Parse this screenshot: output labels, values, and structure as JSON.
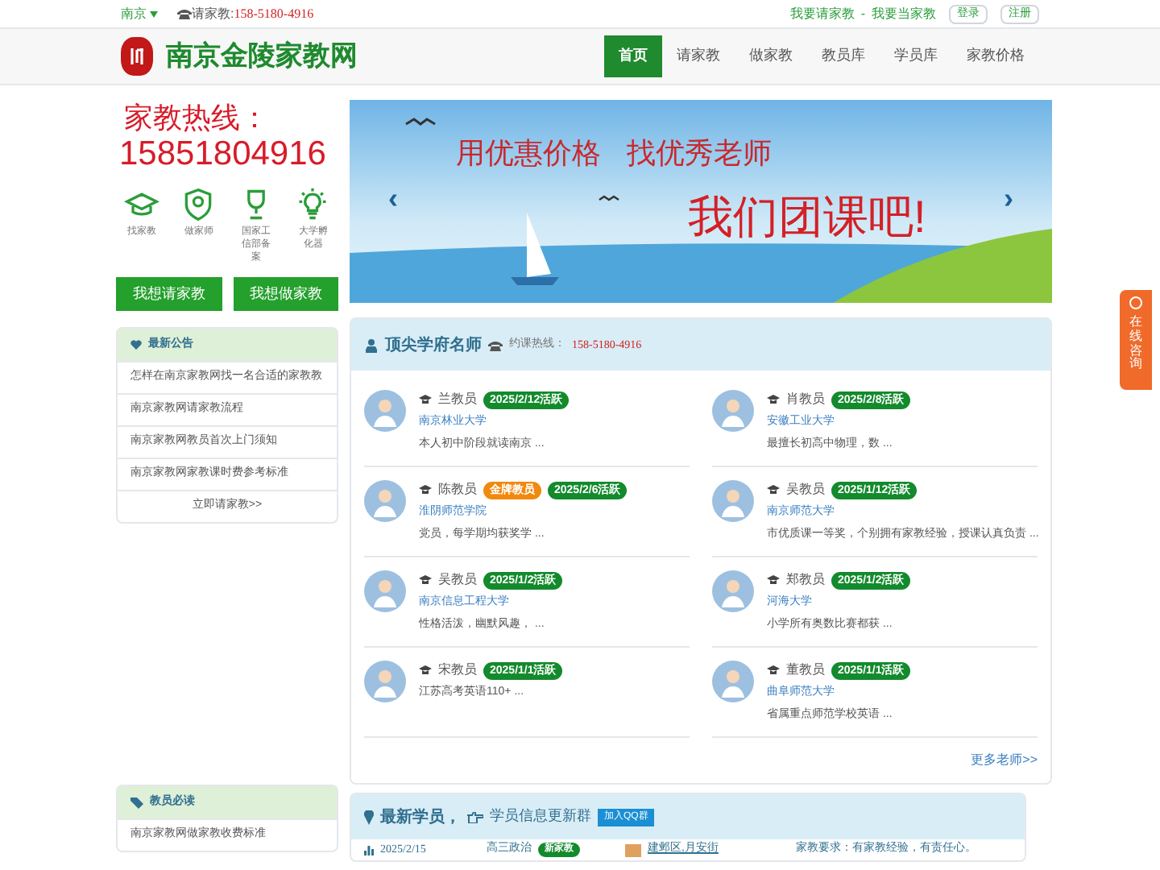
{
  "topbar": {
    "city": "南京",
    "phone_label": "请家教:",
    "phone": "158-5180-4916",
    "links": [
      "我要请家教",
      "-",
      "我要当家教"
    ],
    "buttons": [
      "登录",
      "注册"
    ]
  },
  "header": {
    "site_name": "南京金陵家教网",
    "nav": [
      {
        "label": "首页",
        "selected": true
      },
      {
        "label": "请家教",
        "selected": false
      },
      {
        "label": "做家教",
        "selected": false
      },
      {
        "label": "教员库",
        "selected": false
      },
      {
        "label": "学员库",
        "selected": false
      },
      {
        "label": "家教价格",
        "selected": false
      }
    ]
  },
  "hotline": {
    "title": "家教热线：",
    "number": "15851804916"
  },
  "features": [
    {
      "kind": "cap",
      "label": "找家教"
    },
    {
      "kind": "shield",
      "label": "做家师"
    },
    {
      "kind": "trophy",
      "label": "国家工信部备案"
    },
    {
      "kind": "bulb",
      "label": "大学孵化器"
    }
  ],
  "actions": [
    "我想请家教",
    "我想做家教"
  ],
  "notices": {
    "title": "最新公告",
    "items": [
      "怎样在南京家教网找一名合适的家教教",
      "南京家教网请家教流程",
      "南京家教网教员首次上门须知",
      "南京家教网家教课时费参考标准"
    ],
    "more": "立即请家教>>"
  },
  "banner": {
    "line1": "用优惠价格",
    "line2": "找优秀老师",
    "line3": "我们团课吧!",
    "prev": "‹",
    "next": "›"
  },
  "teachers": {
    "title": "顶尖学府名师",
    "hotline_label": "约课热线：",
    "hotline": "158-5180-4916",
    "more": "更多老师>>",
    "items": [
      {
        "name": "兰教员",
        "badges": [
          {
            "kind": "active",
            "text": "2025/2/12活跃"
          }
        ],
        "school": "南京林业大学",
        "intro": "本人初中阶段就读南京 ..."
      },
      {
        "name": "肖教员",
        "badges": [
          {
            "kind": "active",
            "text": "2025/2/8活跃"
          }
        ],
        "school": "安徽工业大学",
        "intro": "最擅长初高中物理，数 ..."
      },
      {
        "name": "陈教员",
        "badges": [
          {
            "kind": "gold",
            "text": "金牌教员"
          },
          {
            "kind": "active",
            "text": "2025/2/6活跃"
          }
        ],
        "school": "淮阴师范学院",
        "intro": "党员，每学期均获奖学 ..."
      },
      {
        "name": "吴教员",
        "badges": [
          {
            "kind": "active",
            "text": "2025/1/12活跃"
          }
        ],
        "school": "南京师范大学",
        "intro": "市优质课一等奖，个别拥有家教经验，授课认真负责 ..."
      },
      {
        "name": "吴教员",
        "badges": [
          {
            "kind": "active",
            "text": "2025/1/2活跃"
          }
        ],
        "school": "南京信息工程大学",
        "intro": "性格活泼，幽默风趣， ..."
      },
      {
        "name": "郑教员",
        "badges": [
          {
            "kind": "active",
            "text": "2025/1/2活跃"
          }
        ],
        "school": "河海大学",
        "intro": "小学所有奥数比赛都获 ..."
      },
      {
        "name": "宋教员",
        "badges": [
          {
            "kind": "active",
            "text": "2025/1/1活跃"
          }
        ],
        "intro": "江苏高考英语110+ ..."
      },
      {
        "name": "董教员",
        "badges": [
          {
            "kind": "active",
            "text": "2025/1/1活跃"
          }
        ],
        "school": "曲阜师范大学",
        "intro": "省属重点师范学校英语 ..."
      }
    ]
  },
  "side_tab": "在线咨询",
  "must_read": {
    "title": "教员必读",
    "items": [
      "南京家教网做家教收费标准"
    ]
  },
  "students": {
    "title": "最新学员，",
    "group_label": "学员信息更新群",
    "qq_button": "加入QQ群",
    "rows": [
      {
        "date": "2025/2/15",
        "subject": "高三政治",
        "badge": "新家教",
        "location": "建邺区,月安街",
        "requirement": "家教要求：有家教经验，有责任心。"
      }
    ]
  }
}
